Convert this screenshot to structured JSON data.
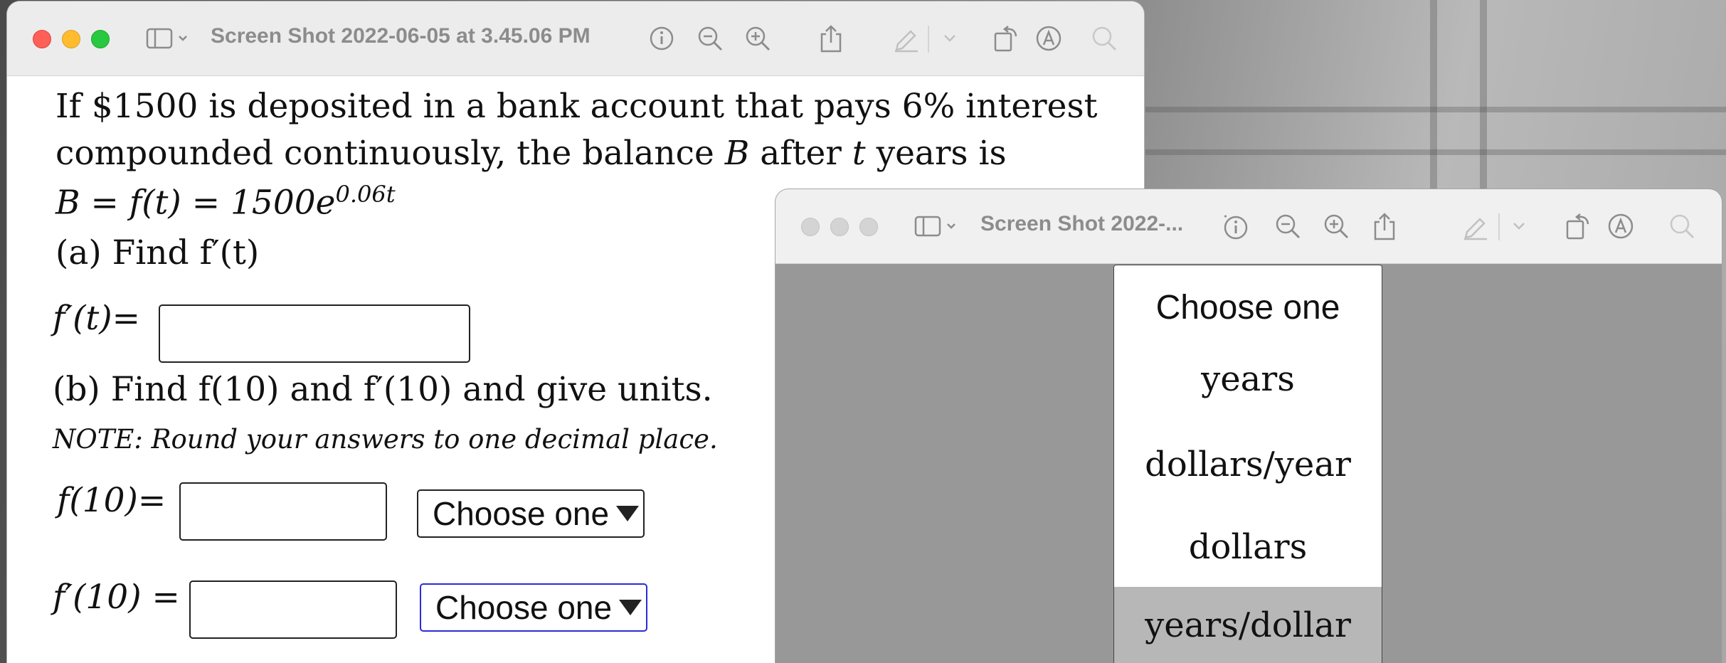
{
  "window1": {
    "title": "Screen Shot 2022-06-05 at 3.45.06 PM",
    "problem": {
      "line1": "If $1500 is deposited in a bank account that pays 6% interest",
      "line2_a": "compounded continuously, the balance ",
      "line2_var_B": "B",
      "line2_b": " after ",
      "line2_var_t": "t",
      "line2_c": " years is",
      "formula_main": "B = f(t) = 1500e",
      "formula_exp": "0.06t",
      "part_a": "(a) Find f′(t)",
      "fprime_t_label": "f′(t)=",
      "part_b": "(b) Find f(10) and f′(10) and give units.",
      "note": "NOTE: Round your answers to one decimal place.",
      "f10_label": "f(10)=",
      "f10_unit": "Choose one",
      "fprime10_label": "f′(10) =",
      "fprime10_unit": "Choose one"
    }
  },
  "window2": {
    "title": "Screen Shot 2022-...",
    "dropdown_options": [
      "Choose one",
      "years",
      "dollars/year",
      "dollars",
      "years/dollar"
    ],
    "highlighted_option": "years/dollar"
  },
  "icons": [
    "close-icon",
    "minimize-icon",
    "zoom-icon",
    "sidebar-icon",
    "chevron-down-icon",
    "info-icon",
    "zoom-out-icon",
    "zoom-in-icon",
    "share-icon",
    "markup-pen-icon",
    "rotate-icon",
    "annotate-icon",
    "search-icon"
  ],
  "colors": {
    "focus_border": "#2b2bd6",
    "highlight": "#b7b7b7",
    "traffic_red": "#fe5f57",
    "traffic_yellow": "#febc2e",
    "traffic_green": "#28c840"
  }
}
